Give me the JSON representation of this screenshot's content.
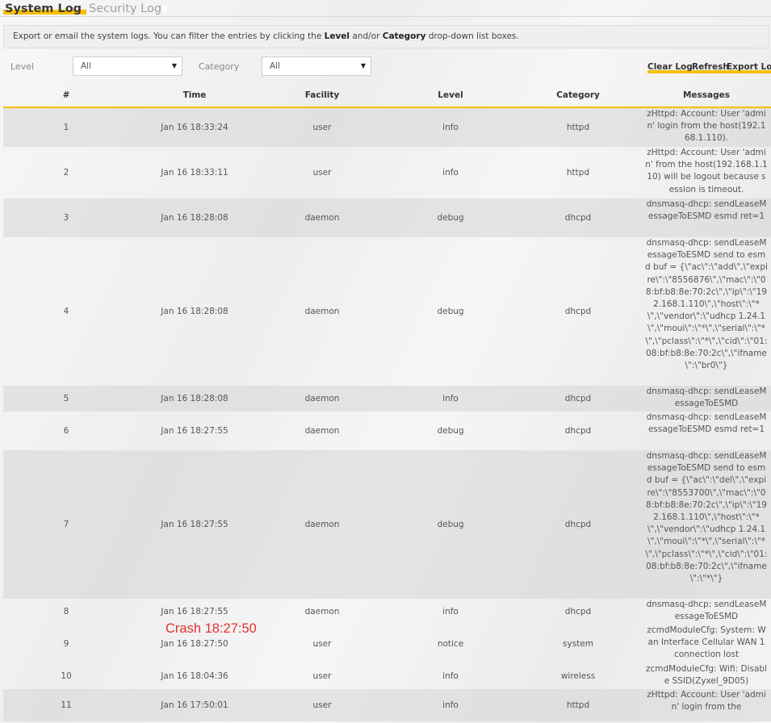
{
  "tabs": [
    {
      "label": "System Log",
      "active": true
    },
    {
      "label": "Security Log",
      "active": false
    }
  ],
  "info": {
    "part1": "Export or email the system logs. You can filter the entries by clicking the ",
    "level_bold": "Level",
    "part2": " and/or ",
    "category_bold": "Category",
    "part3": " drop-down list boxes."
  },
  "filters": {
    "level_label": "Level",
    "level_value": "All",
    "category_label": "Category",
    "category_value": "All"
  },
  "actions": {
    "clear": "Clear Log",
    "refresh": "Refresh",
    "export": "Export Log"
  },
  "table": {
    "headers": [
      "#",
      "Time",
      "Facility",
      "Level",
      "Category",
      "Messages"
    ],
    "rows": [
      {
        "num": "1",
        "time": "Jan 16 18:33:24",
        "facility": "user",
        "level": "info",
        "category": "httpd",
        "message": "zHttpd: Account: User 'admin' login from the host(192.168.1.110)."
      },
      {
        "num": "2",
        "time": "Jan 16 18:33:11",
        "facility": "user",
        "level": "info",
        "category": "httpd",
        "message": "zHttpd: Account: User 'admin' from the host(192.168.1.110) will be logout because session is timeout."
      },
      {
        "num": "3",
        "time": "Jan 16 18:28:08",
        "facility": "daemon",
        "level": "debug",
        "category": "dhcpd",
        "message": "dnsmasq-dhcp: sendLeaseMessageToESMD esmd ret=1"
      },
      {
        "num": "4",
        "time": "Jan 16 18:28:08",
        "facility": "daemon",
        "level": "debug",
        "category": "dhcpd",
        "message": "dnsmasq-dhcp: sendLeaseMessageToESMD send to esmd buf = {\\\"ac\\\":\\\"add\\\",\\\"expire\\\":\\\"8556876\\\",\\\"mac\\\":\\\"08:bf:b8:8e:70:2c\\\",\\\"ip\\\":\\\"192.168.1.110\\\",\\\"host\\\":\\\"*\\\",\\\"vendor\\\":\\\"udhcp 1.24.1\\\",\\\"moui\\\":\\\"*\\\",\\\"serial\\\":\\\"*\\\",\\\"pclass\\\":\\\"*\\\",\\\"cid\\\":\\\"01:08:bf:b8:8e:70:2c\\\",\\\"ifname\\\":\\\"br0\\\"}"
      },
      {
        "num": "5",
        "time": "Jan 16 18:28:08",
        "facility": "daemon",
        "level": "info",
        "category": "dhcpd",
        "message": "dnsmasq-dhcp: sendLeaseMessageToESMD"
      },
      {
        "num": "6",
        "time": "Jan 16 18:27:55",
        "facility": "daemon",
        "level": "debug",
        "category": "dhcpd",
        "message": "dnsmasq-dhcp: sendLeaseMessageToESMD esmd ret=1"
      },
      {
        "num": "7",
        "time": "Jan 16 18:27:55",
        "facility": "daemon",
        "level": "debug",
        "category": "dhcpd",
        "message": "dnsmasq-dhcp: sendLeaseMessageToESMD send to esmd buf = {\\\"ac\\\":\\\"del\\\",\\\"expire\\\":\\\"8553700\\\",\\\"mac\\\":\\\"08:bf:b8:8e:70:2c\\\",\\\"ip\\\":\\\"192.168.1.110\\\",\\\"host\\\":\\\"*\\\",\\\"vendor\\\":\\\"udhcp 1.24.1\\\",\\\"moui\\\":\\\"*\\\",\\\"serial\\\":\\\"*\\\",\\\"pclass\\\":\\\"*\\\",\\\"cid\\\":\\\"01:08:bf:b8:8e:70:2c\\\",\\\"ifname\\\":\\\"*\\\"}"
      },
      {
        "num": "8",
        "time": "Jan 16 18:27:55",
        "facility": "daemon",
        "level": "info",
        "category": "dhcpd",
        "message": "dnsmasq-dhcp: sendLeaseMessageToESMD"
      },
      {
        "num": "9",
        "time": "Jan 16 18:27:50",
        "facility": "user",
        "level": "notice",
        "category": "system",
        "message": "zcmdModuleCfg: System: Wan Interface Cellular WAN 1 connection lost"
      },
      {
        "num": "10",
        "time": "Jan 16 18:04:36",
        "facility": "user",
        "level": "info",
        "category": "wireless",
        "message": "zcmdModuleCfg: Wifi: Disable SSID(Zyxel_9D05)"
      },
      {
        "num": "11",
        "time": "Jan 16 17:50:01",
        "facility": "user",
        "level": "info",
        "category": "httpd",
        "message": "zHttpd: Account: User 'admin' login from the"
      }
    ]
  },
  "annotation": "Crash 18:27:50"
}
